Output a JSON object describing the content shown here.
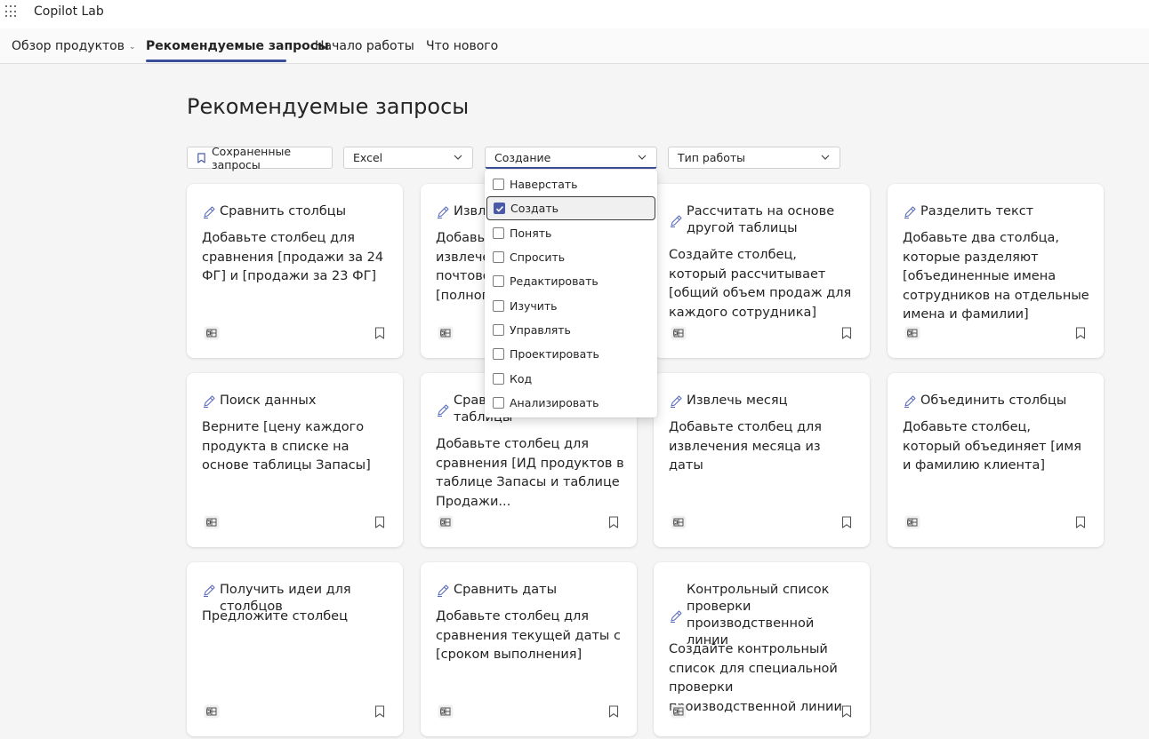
{
  "app": {
    "title": "Copilot Lab"
  },
  "nav": {
    "items": [
      {
        "label": "Обзор продуктов"
      },
      {
        "label": "Рекомендуемые запросы"
      },
      {
        "label": "Начало работы"
      },
      {
        "label": "Что нового"
      }
    ]
  },
  "page": {
    "title": "Рекомендуемые запросы"
  },
  "filters": {
    "saved": "Сохраненные запросы",
    "app": "Excel",
    "action": "Создание",
    "work_type": "Тип работы"
  },
  "dropdown": {
    "options": [
      {
        "label": "Наверстать",
        "checked": false
      },
      {
        "label": "Создать",
        "checked": true
      },
      {
        "label": "Понять",
        "checked": false
      },
      {
        "label": "Спросить",
        "checked": false
      },
      {
        "label": "Редактировать",
        "checked": false
      },
      {
        "label": "Изучить",
        "checked": false
      },
      {
        "label": "Управлять",
        "checked": false
      },
      {
        "label": "Проектировать",
        "checked": false
      },
      {
        "label": "Код",
        "checked": false
      },
      {
        "label": "Анализировать",
        "checked": false
      }
    ]
  },
  "cards": [
    {
      "title": "Сравнить столбцы",
      "body": "Добавьте столбец для сравнения [продажи за 24 ФГ] и [продажи за 23 ФГ]"
    },
    {
      "title": "Извле",
      "body": "Добавьте извлечен почтовог [полного"
    },
    {
      "title": "Рассчитать на основе другой таблицы",
      "body": "Создайте столбец, который рассчитывает [общий объем продаж для каждого сотрудника]"
    },
    {
      "title": "Разделить текст",
      "body": "Добавьте два столбца, которые разделяют [объединенные имена сотрудников на отдельные имена и фамилии]"
    },
    {
      "title": "Поиск данных",
      "body": "Верните [цену каждого продукта в списке на основе таблицы Запасы]"
    },
    {
      "title": "Сравн таблицы",
      "body": "Добавьте столбец для сравнения [ИД продуктов в таблице Запасы и таблице Продажи..."
    },
    {
      "title": "Извлечь месяц",
      "body": "Добавьте столбец для извлечения месяца из даты"
    },
    {
      "title": "Объединить столбцы",
      "body": "Добавьте столбец, который объединяет [имя и фамилию клиента]"
    },
    {
      "title": "Получить идеи для столбцов",
      "body": "Предложите столбец"
    },
    {
      "title": "Сравнить даты",
      "body": "Добавьте столбец для сравнения текущей даты с [сроком выполнения]"
    },
    {
      "title": "Контрольный список проверки производственной линии",
      "body": "Создайте контрольный список для специальной проверки производственной линии"
    }
  ],
  "icons": {
    "menu": "waffle-icon",
    "pen": "pen-icon",
    "excel": "excel-icon",
    "bookmark": "bookmark-icon",
    "chevron": "chevron-down-icon",
    "check": "checkmark-icon"
  },
  "colors": {
    "accent": "#3b4e9a",
    "checkbox_checked": "#4a5aa8"
  }
}
